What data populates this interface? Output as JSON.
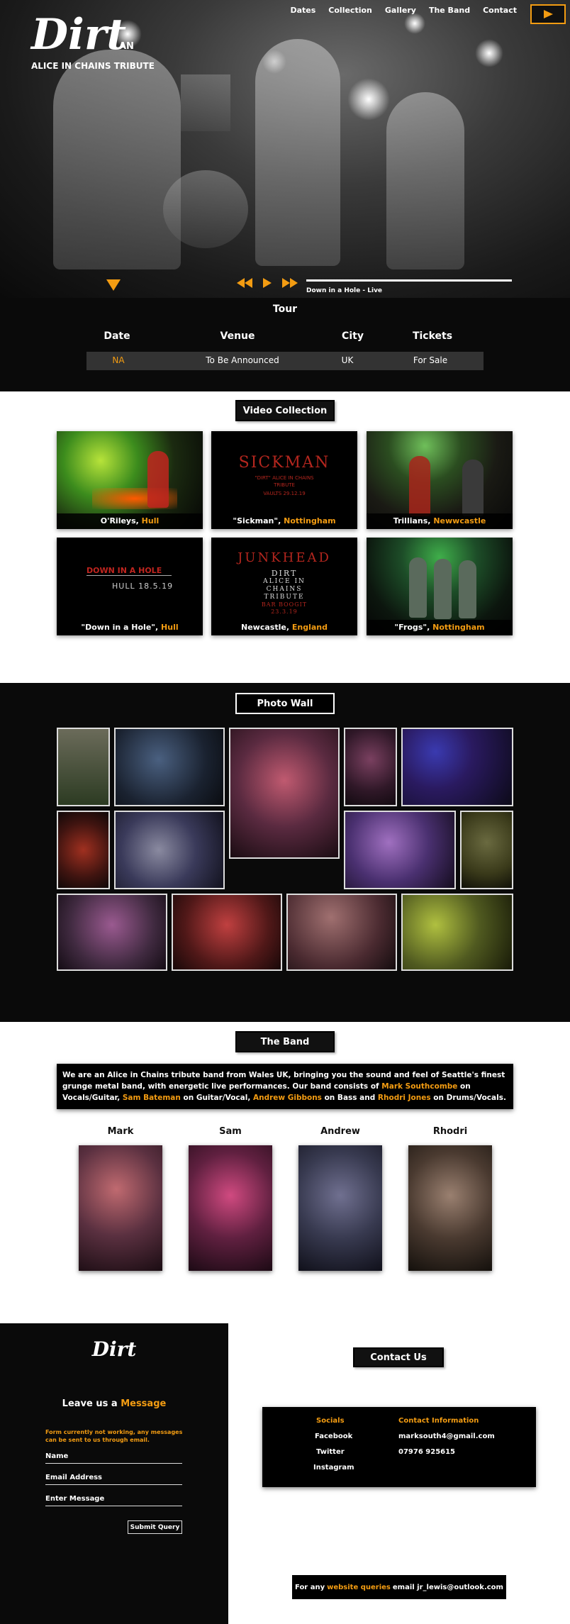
{
  "header": {
    "logo": "Dirt",
    "tagline_an": "AN",
    "tagline": "ALICE IN CHAINS TRIBUTE",
    "nav": [
      "Dates",
      "Collection",
      "Gallery",
      "The Band",
      "Contact"
    ],
    "player_icon": "play-icon"
  },
  "player": {
    "track": "Down in a Hole - Live",
    "progress": 0.97
  },
  "tour": {
    "title": "Tour",
    "columns": [
      "Date",
      "Venue",
      "City",
      "Tickets"
    ],
    "rows": [
      {
        "date": "NA",
        "venue": "To Be Announced",
        "city": "UK",
        "tickets": "For Sale"
      }
    ]
  },
  "videos": {
    "title": "Video Collection",
    "items": [
      {
        "name": "O'Rileys,",
        "place": "Hull"
      },
      {
        "name": "\"Sickman\",",
        "place": "Nottingham"
      },
      {
        "name": "Trillians,",
        "place": "Newwcastle"
      },
      {
        "name": "\"Down in a Hole\",",
        "place": "Hull"
      },
      {
        "name": "Newcastle,",
        "place": "England"
      },
      {
        "name": "\"Frogs\",",
        "place": "Nottingham"
      }
    ],
    "poster_sickman": {
      "title": "SICKMAN",
      "line1": "\"DIRT\" ALICE IN CHAINS",
      "line2": "TRIBUTE",
      "line3": "VAULTS 29.12.19"
    },
    "poster_hole": {
      "title": "DOWN IN A HOLE",
      "line1": "HULL 18.5.19"
    },
    "poster_junkhead": {
      "title": "JUNKHEAD",
      "line1": "DIRT",
      "line2": "ALICE IN",
      "line3": "CHAINS",
      "line4": "TRIBUTE",
      "line5": "BAR BOOGIT",
      "line6": "23.3.19"
    }
  },
  "gallery": {
    "title": "Photo Wall"
  },
  "band": {
    "title": "The Band",
    "desc_1": "We are an Alice in Chains tribute band from Wales UK, bringing you the sound and feel of Seattle's finest grunge metal band, with energetic live performances. Our band consists of ",
    "mark_link": "Mark Southcombe",
    "desc_2": " on Vocals/Guitar, ",
    "sam_link": "Sam Bateman",
    "desc_3": " on Guitar/Vocal, ",
    "andrew_link": "Andrew Gibbons",
    "desc_4": " on Bass and ",
    "rhodri_link": "Rhodri Jones",
    "desc_5": " on Drums/Vocals.",
    "members": [
      "Mark",
      "Sam",
      "Andrew",
      "Rhodri"
    ]
  },
  "contact": {
    "logo": "Dirt",
    "leave": "Leave us a ",
    "message_word": "Message",
    "notice": "Form currently not working, any messages can be sent to us through email.",
    "name_placeholder": "Name",
    "email_placeholder": "Email Address",
    "message_placeholder": "Enter Message",
    "submit": "Submit Query",
    "title": "Contact Us",
    "socials_title": "Socials",
    "socials": [
      "Facebook",
      "Twitter",
      "Instagram"
    ],
    "info_title": "Contact Information",
    "email": "marksouth4@gmail.com",
    "phone": "07976 925615",
    "webq_1": "For any ",
    "webq_link": "website queries",
    "webq_2": " email jr_lewis@outlook.com"
  },
  "colors": {
    "accent": "#f39c12",
    "dark": "#0a0a0a"
  }
}
